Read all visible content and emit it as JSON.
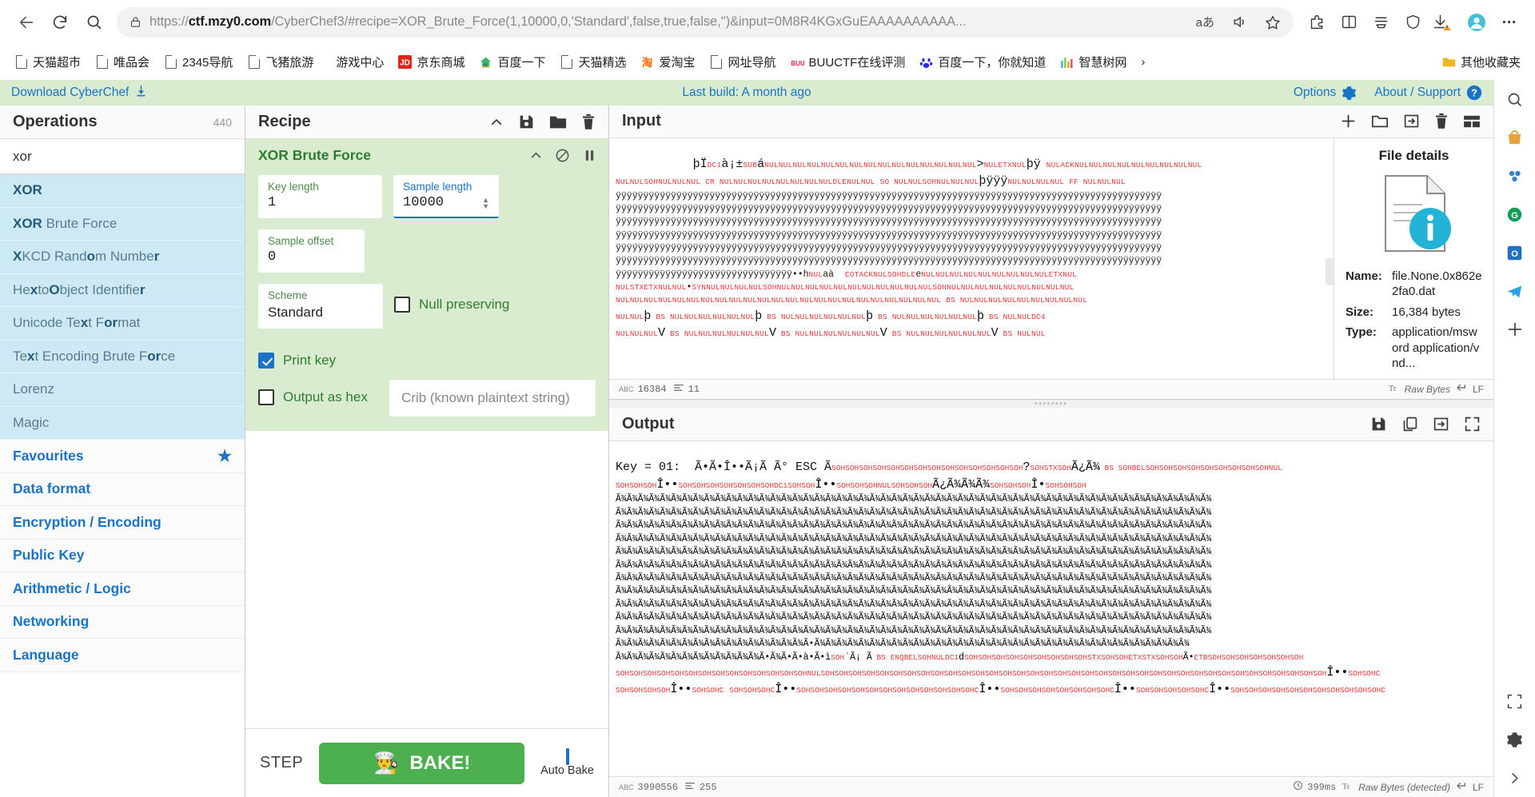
{
  "browser": {
    "url_prefix": "https://",
    "url_host": "ctf.mzy0.com",
    "url_rest": "/CyberChef3/#recipe=XOR_Brute_Force(1,10000,0,'Standard',false,true,false,'')&input=0M8R4KGxGuEAAAAAAAAAA...",
    "url_full": "https://ctf.mzy0.com/CyberChef3/#recipe=XOR_Brute_Force(1,10000,0,'Standard',false,true,false,'')&input=0M8R4KGxGuEAAAAAAAAAA...",
    "reader_mode_label": "aあ",
    "bookmarks": [
      {
        "label": "天猫超市",
        "icon": "page-icon"
      },
      {
        "label": "唯品会",
        "icon": "page-icon"
      },
      {
        "label": "2345导航",
        "icon": "page-icon"
      },
      {
        "label": "飞猪旅游",
        "icon": "page-icon"
      },
      {
        "label": "游戏中心",
        "icon": "none"
      },
      {
        "label": "京东商城",
        "icon": "jd-icon"
      },
      {
        "label": "百度一下",
        "icon": "baidu-home-icon"
      },
      {
        "label": "天猫精选",
        "icon": "page-icon"
      },
      {
        "label": "爱淘宝",
        "icon": "taobao-icon"
      },
      {
        "label": "网址导航",
        "icon": "page-icon"
      },
      {
        "label": "BUUCTF在线评测",
        "icon": "buuctf-icon"
      },
      {
        "label": "百度一下，你就知道",
        "icon": "baidu-paw-icon"
      },
      {
        "label": "智慧树网",
        "icon": "zhihuishu-icon"
      }
    ],
    "other_bookmarks": "其他收藏夹"
  },
  "cyberchef": {
    "download_label": "Download CyberChef",
    "last_build": "Last build: A month ago",
    "options_label": "Options",
    "about_label": "About / Support"
  },
  "operations": {
    "title": "Operations",
    "count": "440",
    "search_value": "xor",
    "results": [
      {
        "bold": "XOR",
        "rest": ""
      },
      {
        "bold": "XOR",
        "rest": " Brute Force"
      },
      {
        "bold": "X",
        "rest": "KCD Random Number",
        "pattern": "XKCD Random Number"
      },
      {
        "bold": "",
        "rest": "Hex to Object Identifier"
      },
      {
        "bold": "",
        "rest": "Unicode Text Format"
      },
      {
        "bold": "",
        "rest": "Text Encoding Brute Force"
      },
      {
        "bold": "",
        "rest": "Lorenz"
      },
      {
        "bold": "",
        "rest": "Magic"
      }
    ],
    "categories": [
      {
        "label": "Favourites",
        "starred": true
      },
      {
        "label": "Data format",
        "starred": false
      },
      {
        "label": "Encryption / Encoding",
        "starred": false
      },
      {
        "label": "Public Key",
        "starred": false
      },
      {
        "label": "Arithmetic / Logic",
        "starred": false
      },
      {
        "label": "Networking",
        "starred": false
      },
      {
        "label": "Language",
        "starred": false
      }
    ]
  },
  "recipe": {
    "title": "Recipe",
    "operation": {
      "name": "XOR Brute Force",
      "args": {
        "key_length_label": "Key length",
        "key_length_value": "1",
        "sample_length_label": "Sample length",
        "sample_length_value": "10000",
        "sample_offset_label": "Sample offset",
        "sample_offset_value": "0",
        "scheme_label": "Scheme",
        "scheme_value": "Standard",
        "null_preserving_label": "Null preserving",
        "null_preserving_checked": false,
        "print_key_label": "Print key",
        "print_key_checked": true,
        "output_as_hex_label": "Output as hex",
        "output_as_hex_checked": false,
        "crib_placeholder": "Crib (known plaintext string)"
      }
    },
    "footer": {
      "step_label": "STEP",
      "bake_label": "BAKE!",
      "auto_bake_label": "Auto Bake",
      "auto_bake_checked": true
    }
  },
  "input": {
    "title": "Input",
    "status_length": "16384",
    "status_lines": "11",
    "encoding_label": "Raw Bytes",
    "line_ending_label": "LF",
    "content_lines": [
      "þÏ DC1 à ¡ ± SUB á NULNULNULNULNULNULNULNULNULNULNULNULNULNULNUL > NULETXNUL þÿ   NULACKNULNULNULNULNULNULNULNULNUL",
      "NULNULSOHNULNULNUL CR NULNULNULNULNULNULNULNULDLENULNUL SO NULNULSOHNULNULNUL þÿÿÿ NULNULNULNUL FF NULNULNUL",
      "ÿÿÿÿÿÿÿÿÿÿÿÿÿÿÿÿÿÿÿÿÿÿÿÿÿÿÿÿÿÿÿÿÿÿÿÿÿÿÿÿÿÿÿÿÿÿÿÿÿÿÿÿÿÿÿÿÿÿÿÿÿÿÿÿÿÿÿÿÿÿÿÿÿÿÿÿÿÿÿÿÿÿÿÿÿÿÿÿ",
      "ÿÿÿÿÿÿÿÿÿÿÿÿÿÿÿÿÿÿÿÿÿÿÿÿÿÿÿÿÿÿÿÿÿÿÿÿÿÿÿÿÿÿÿÿÿÿÿÿÿÿÿÿÿÿÿÿÿÿÿÿÿÿÿÿÿÿÿÿÿÿÿÿÿÿÿÿÿÿÿÿÿÿÿÿÿÿÿÿ",
      "ÿÿÿÿÿÿÿÿÿÿÿÿÿÿÿÿÿÿÿÿÿÿÿÿÿÿÿÿÿÿÿÿÿÿÿÿÿÿÿÿÿÿÿÿÿÿÿÿÿÿÿÿÿÿÿÿÿÿÿÿÿÿÿÿÿÿÿÿÿÿÿÿÿÿÿÿÿÿÿÿÿÿÿÿÿÿÿÿ",
      "ÿÿÿÿÿÿÿÿÿÿÿÿÿÿÿÿÿÿÿÿÿÿÿÿÿÿÿÿÿÿÿÿÿÿÿÿÿÿÿÿÿÿÿÿÿÿÿÿÿÿÿÿÿÿÿÿÿÿÿÿÿÿÿÿÿÿÿÿÿÿÿÿÿÿÿÿÿÿÿÿÿÿÿÿÿÿÿÿ",
      "ÿÿÿÿÿÿÿÿÿÿÿÿÿÿÿÿÿÿÿÿÿÿÿÿÿÿÿÿÿÿÿÿÿÿÿÿÿÿÿÿÿÿÿÿÿÿÿÿÿÿÿÿÿÿÿÿÿÿÿÿÿÿÿÿÿÿÿÿÿÿÿÿÿÿÿÿÿÿÿÿÿÿÿÿÿÿÿÿ",
      "ÿÿÿÿÿÿÿÿÿÿÿÿÿÿÿÿÿÿÿÿÿÿÿÿÿÿÿÿÿÿÿÿÿÿÿÿÿÿÿÿÿÿÿÿÿÿÿÿÿÿÿÿÿÿÿÿÿÿÿÿÿÿÿÿÿÿÿÿÿÿÿÿÿÿÿÿÿÿÿÿÿÿÿÿÿÿÿÿ",
      "ÿÿÿÿÿÿÿÿÿÿÿÿÿÿÿÿÿÿÿÿÿÿÿÿÿÿÿÿÿÿÿÿÿÿ • • hNULaà  EOTACKNULSOHDLE e NULNULNULNULNULNULNULNULNULETXNUL",
      "NULSTXETXNULNUL • SYNNULNULNULNULSOHNULNULNULNULNULNULNULNULNULNULNULSOHNULNULNULNULNULNULNULNULNUL",
      "NULNULNULNULNULNULNULNULNULNULNULNULNULNULNULNULNULNULNULNULNULNULNUL BS NULNULNULNULNULNULNULNULNUL",
      "NULNUL þ BS NULNULNULNULNULNUL þ BS NULNULNULNULNULNUL þ BS NULNULNULNULNULNUL þ BS NULNULDC4",
      "NULNULNUL V BS NULNULNULNULNULNUL V BS NULNULNULNULNULNUL V BS NULNULNULNULNULNUL V BS NULNUL"
    ]
  },
  "file_details": {
    "title": "File details",
    "name_label": "Name:",
    "name_value": "file.None.0x862e2fa0.dat",
    "size_label": "Size:",
    "size_value": "16,384 bytes",
    "type_label": "Type:",
    "type_value": "application/msword application/vnd..."
  },
  "output": {
    "title": "Output",
    "status_length": "3990556",
    "status_lines": "255",
    "duration": "399ms",
    "encoding_label": "Raw Bytes (detected)",
    "line_ending_label": "LF",
    "key_line": "Key = 01:  Ã•Ã•Î••Ã¡Ã Ã° ESC Ã",
    "content_lines": [
      "SOHSOHSOHSOHSOHSOHSOHSOHSOHSOHSOHSOHSOHSOH ? SOHSTXSOHÃ¿Ã¾ BS SOHBELSOHSOHSOHSOHSOHSOHSOHSOHSOHNUL",
      "SOHSOHSOHÎ • • SOHSOHSOHSOHSOHSOHSOHDC1SOHSOHÎ • • SOHSOHSOHNULSOHSOHÃ¿Ã¾Ã¾Ã¾ SOHSOHSOHÎ • SOHSOHSOH",
      "Ã¾Ã¾Ã¾Ã¾Ã¾Ã¾Ã¾Ã¾Ã¾Ã¾Ã¾Ã¾Ã¾Ã¾Ã¾Ã¾Ã¾Ã¾Ã¾Ã¾Ã¾Ã¾Ã¾Ã¾Ã¾Ã¾Ã¾Ã¾Ã¾Ã¾Ã¾Ã¾Ã¾Ã¾Ã¾Ã¾Ã¾Ã¾Ã¾Ã¾",
      "Ã¾Ã¾Ã¾Ã¾Ã¾Ã¾Ã¾Ã¾Ã¾Ã¾Ã¾Ã¾Ã¾Ã¾Ã¾Ã¾Ã¾Ã¾Ã¾Ã¾Ã¾Ã¾Ã¾Ã¾Ã¾Ã¾Ã¾Ã¾Ã¾Ã¾Ã¾Ã¾Ã¾Ã¾Ã¾Ã¾Ã¾Ã¾Ã¾Ã¾",
      "Ã¾Ã¾Ã¾Ã¾Ã¾Ã¾Ã¾Ã¾Ã¾Ã¾Ã¾Ã¾Ã¾Ã¾Ã¾Ã¾Ã¾Ã¾Ã¾Ã¾Ã¾Ã¾Ã¾Ã¾Ã¾Ã¾Ã¾Ã¾Ã¾Ã¾Ã¾Ã¾Ã¾Ã¾Ã¾Ã¾Ã¾Ã¾Ã¾Ã¾",
      "Ã¾Ã¾Ã¾Ã¾Ã¾Ã¾Ã¾Ã¾Ã¾Ã¾Ã¾Ã¾Ã¾Ã¾Ã¾Ã¾Ã¾Ã¾Ã¾Ã¾Ã¾Ã¾Ã¾Ã¾Ã¾Ã¾Ã¾Ã¾Ã¾Ã¾Ã¾Ã¾Ã¾Ã¾Ã¾Ã¾Ã¾Ã¾Ã¾Ã¾",
      "Ã¾Ã¾Ã¾Ã¾Ã¾Ã¾Ã¾Ã¾Ã¾Ã¾Ã¾Ã¾Ã¾Ã¾Ã¾Ã¾Ã¾Ã¾Ã¾Ã¾Ã¾Ã¾Ã¾Ã¾Ã¾Ã¾Ã¾Ã¾Ã¾Ã¾Ã¾Ã¾Ã¾Ã¾Ã¾Ã¾Ã¾Ã¾Ã¾Ã¾",
      "Ã¾Ã¾Ã¾Ã¾Ã¾Ã¾Ã¾Ã¾Ã¾Ã¾Ã¾Ã¾Ã¾Ã¾Ã¾Ã¾Ã¾Ã¾Ã¾Ã¾Ã¾Ã¾Ã¾Ã¾Ã¾Ã¾Ã¾Ã¾Ã¾Ã¾Ã¾Ã¾Ã¾Ã¾Ã¾Ã¾Ã¾Ã¾Ã¾Ã¾",
      "Ã¾Ã¾Ã¾Ã¾Ã¾Ã¾Ã¾Ã¾Ã¾Ã¾Ã¾Ã¾Ã¾Ã¾Ã¾Ã¾Ã¾Ã¾Ã¾Ã¾Ã¾Ã¾Ã¾Ã¾Ã¾Ã¾Ã¾Ã¾Ã¾Ã¾Ã¾Ã¾Ã¾Ã¾Ã¾Ã¾Ã¾Ã¾Ã¾Ã¾",
      "Ã¾Ã¾Ã¾Ã¾Ã¾Ã¾Ã¾Ã¾Ã¾Ã¾Ã¾Ã¾Ã¾Ã¾Ã¾Ã¾Ã¾Ã¾Ã¾Ã¾Ã¾Ã¾Ã¾Ã¾Ã¾Ã¾Ã¾Ã¾Ã¾Ã¾Ã¾Ã¾Ã¾Ã¾Ã¾Ã¾Ã¾Ã¾Ã¾Ã¾",
      "Ã¾Ã¾Ã¾Ã¾Ã¾Ã¾Ã¾Ã¾Ã¾Ã¾Ã¾Ã¾Ã¾Ã¾Ã¾Ã¾Ã¾Ã¾Ã¾Ã¾Ã¾Ã¾Ã¾Ã¾Ã¾Ã¾Ã¾Ã¾Ã¾Ã¾Ã¾Ã¾Ã¾Ã¾Ã¾Ã¾Ã¾Ã¾Ã¾Ã¾",
      "Ã¾Ã¾Ã¾Ã¾Ã¾Ã¾Ã¾Ã¾Ã¾Ã¾Ã¾Ã¾Ã¾Ã¾Ã¾Ã¾Ã¾Ã¾Ã¾Ã¾Ã¾Ã¾Ã¾Ã¾Ã¾Ã¾Ã¾Ã¾Ã¾Ã¾Ã¾Ã¾Ã¾Ã¾Ã¾Ã¾Ã¾Ã¾Ã¾Ã¾",
      "Ã¾Ã¾Ã¾Ã¾Ã¾Ã¾Ã¾Ã¾Ã¾Ã¾Ã¾Ã¾Ã¾Ã¾Ã¾Ã¾Ã¾Ã¾Ã¾Ã¾Ã¾Ã¾Ã¾Ã¾Ã¾Ã¾Ã¾Ã¾Ã¾Ã¾Ã¾Ã¾Ã¾Ã¾Ã¾Ã¾Ã¾Ã¾Ã¾Ã¾",
      "Ã¾Ã¾Ã¾Ã¾Ã¾Ã¾Ã¾Ã¾Ã¾Ã¾Ã¾Ã¾Ã¾Ã¾Ã¾Ã¾Ã¾Ã•Ã¾Ã¾Ã¾Ã¾Ã¾Ã¾Ã¾Ã¾Ã¾Ã¾Ã¾Ã¾Ã¾Ã¾Ã¾Ã¾Ã¾Ã¾Ã¾Ã¾",
      "Ã¾Ã¾Ã¾Ã¾Ã¾Ã¾Ã¾Ã¾Ã¾Ã¾Ã¾Ã¾Ã¾Ã•Ã¾Ã•Ã•à • Ã• ì SOH ` Ã¡ Ã BS ENQBELSOHNULDC1 d SOHSOHSOHSOHSOHSOHSOHSOHSOHSTXSOHSOHETXSTXSOHSOHÃ • ETBSOHSOHSOHSOHSOHSOHSOH",
      "SOHSOHSOHSOHSOHSOHSOHSOHSOHSOHSOHSOHSOHSOHNULSOHSOHSOHSOHSOHSOHSOHSOHSOHSOHSOHSOHSOHSOHSOHSOHSOHSOHSOHSOHSOHSOHSOHSOHSOHSOHSOHSOHSOHSOHSOHSOHSOHSOHSOHSOHSOHSOHÎ • • SOHSOHC",
      "SOHSOHSOHSOHÎ • • SOHSOHC SOHSOHSOHC Î • • SOHSOHSOHSOHSOHSOHSOHSOHSOHSOHSOHSOHSOHC Î • • SOHSOHSOHSOHSOHSOHSOHSOHC Î • • SOHSOHSOHSOHSOHC Î • • SOHSOHSOHSOHSOHSOHSOHSOHSOHSOHSOHC"
    ]
  }
}
